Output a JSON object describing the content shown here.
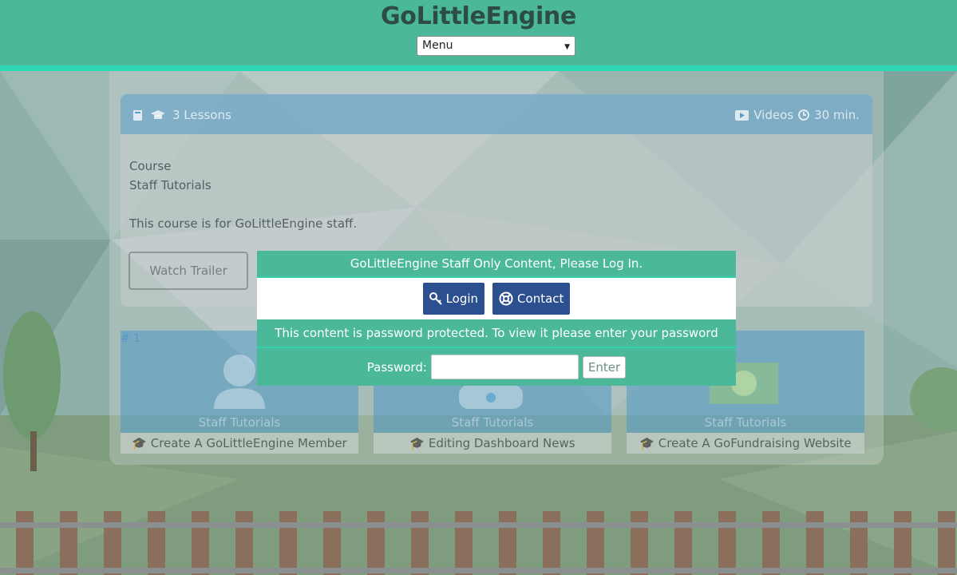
{
  "header": {
    "title": "GoLittleEngine",
    "menu": {
      "selected": "Menu"
    }
  },
  "course": {
    "lessons": "3 Lessons",
    "videos": "Videos",
    "duration": "30 min.",
    "label": "Course",
    "name": "Staff Tutorials",
    "description": "This course is for GoLittleEngine staff.",
    "trailer_label": "Watch Trailer",
    "lesson_number": "# 1",
    "lessons_list": [
      {
        "category": "Staff Tutorials",
        "title": "Create A GoLittleEngine Member"
      },
      {
        "category": "Staff Tutorials",
        "title": "Editing Dashboard News"
      },
      {
        "category": "Staff Tutorials",
        "title": "Create A GoFundraising Website"
      }
    ]
  },
  "modal": {
    "heading": "GoLittleEngine Staff Only Content, Please Log In.",
    "login_label": "Login",
    "contact_label": "Contact",
    "message": "This content is password protected. To view it please enter your password below:",
    "password_label": "Password:",
    "password_value": "",
    "enter_label": "Enter"
  },
  "colors": {
    "header": "#4bb89a",
    "accent": "#2fd6b4",
    "button": "#2c4f8f"
  },
  "icons": {
    "book": "book-icon",
    "cap": "graduation-cap-icon",
    "video": "video-icon",
    "clock": "clock-icon",
    "key": "key-icon",
    "lifebuoy": "lifebuoy-icon"
  }
}
